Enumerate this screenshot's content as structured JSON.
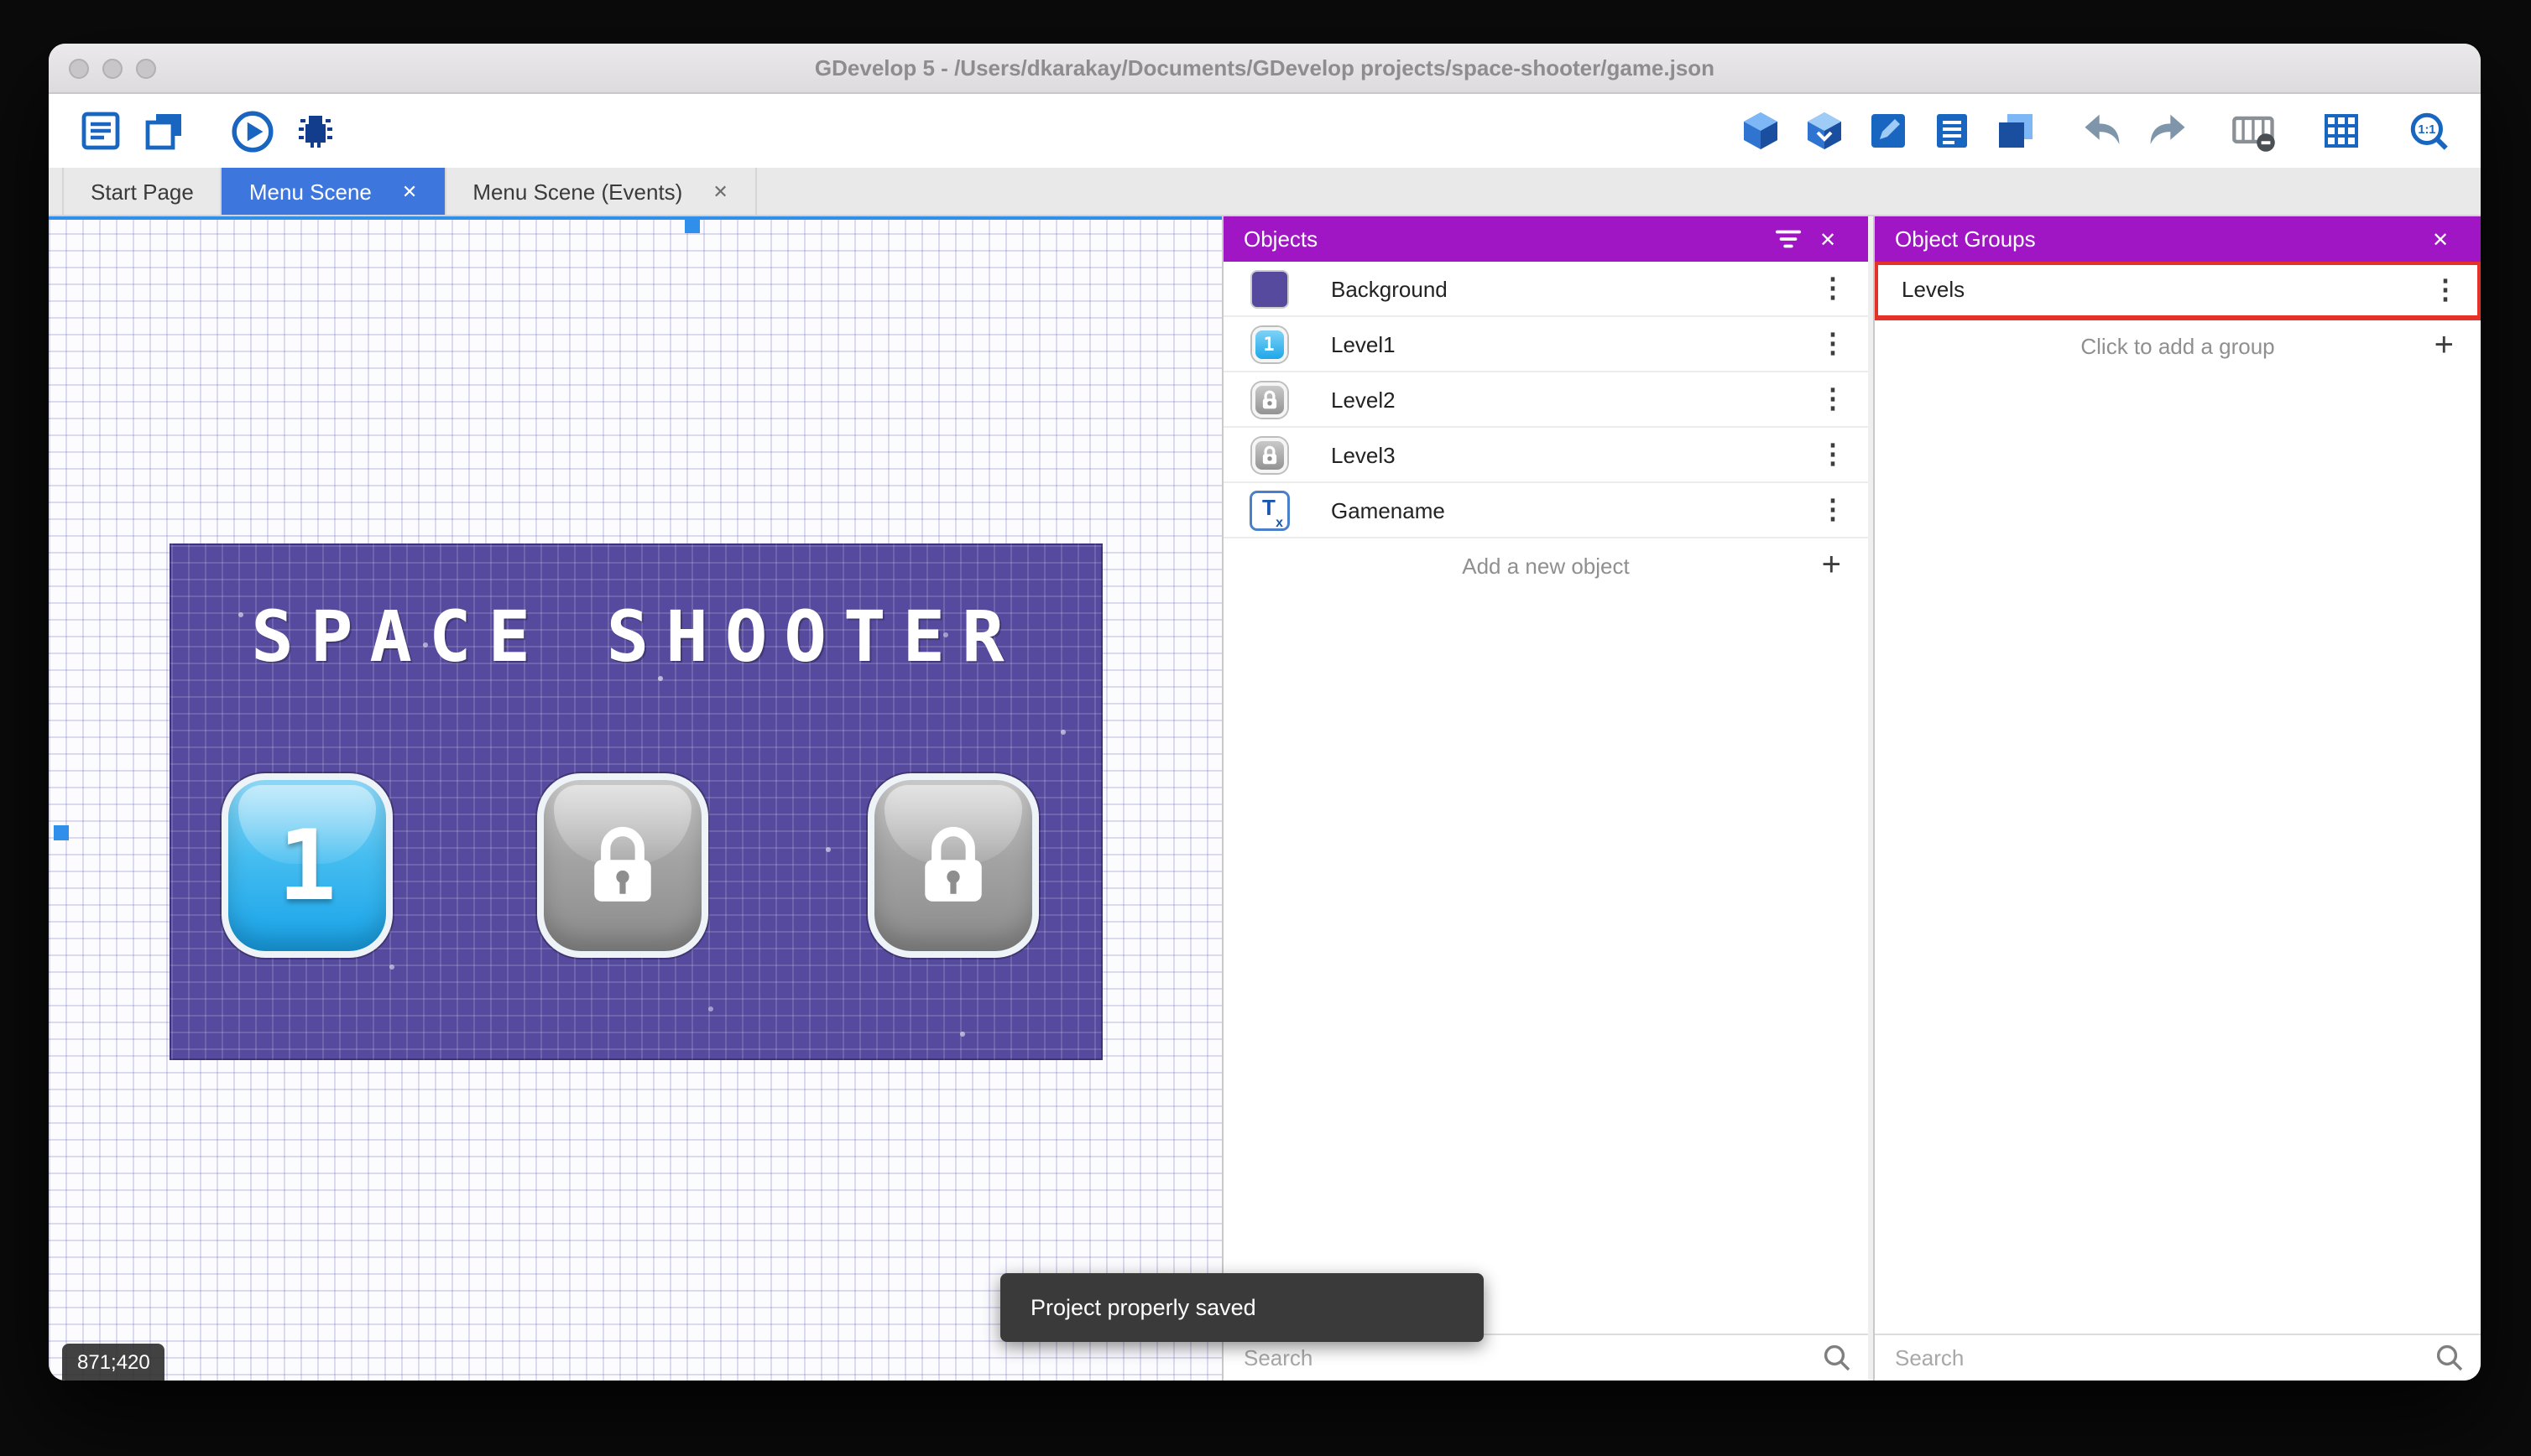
{
  "window": {
    "title": "GDevelop 5 - /Users/dkarakay/Documents/GDevelop projects/space-shooter/game.json"
  },
  "tabs": [
    {
      "label": "Start Page"
    },
    {
      "label": "Menu Scene"
    },
    {
      "label": "Menu Scene (Events)"
    }
  ],
  "toolbar": {
    "zoom_label": "1:1"
  },
  "canvas": {
    "coordinates": "871;420",
    "toast": "Project properly saved",
    "scene": {
      "title": "SPACE SHOOTER",
      "level1_label": "1"
    }
  },
  "objects_panel": {
    "title": "Objects",
    "items": [
      {
        "name": "Background"
      },
      {
        "name": "Level1",
        "badge": "1"
      },
      {
        "name": "Level2"
      },
      {
        "name": "Level3"
      },
      {
        "name": "Gamename"
      }
    ],
    "add_label": "Add a new object",
    "search_placeholder": "Search"
  },
  "groups_panel": {
    "title": "Object Groups",
    "items": [
      {
        "name": "Levels"
      }
    ],
    "add_label": "Click to add a group",
    "search_placeholder": "Search"
  },
  "glyphs": {
    "close": "✕",
    "kebab": "⋮",
    "plus": "+",
    "text_icon": "T",
    "text_icon_sub": "x"
  },
  "colors": {
    "panel_header_purple": "#a016c4",
    "active_tab_blue": "#3d77dd",
    "annotation_red": "#e53228",
    "scene_background_purple": "#564a9e",
    "toolbar_icon_blue": "#1866c0",
    "toast_gray": "#3a3a3a"
  }
}
